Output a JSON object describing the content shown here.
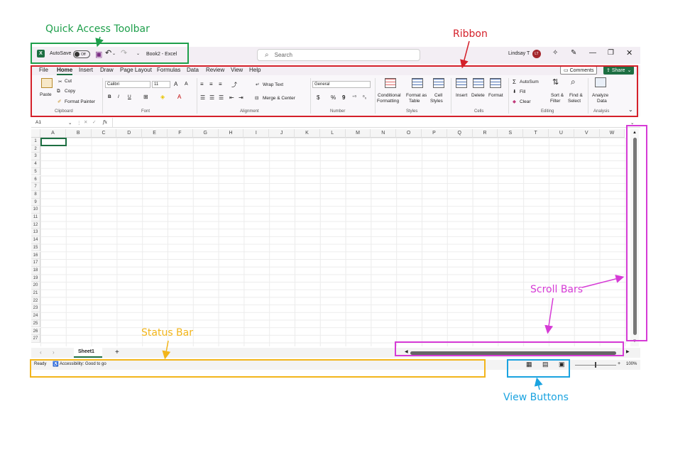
{
  "annotations": {
    "quick_access": "Quick Access Toolbar",
    "ribbon": "Ribbon",
    "scroll_bars": "Scroll Bars",
    "status_bar": "Status Bar",
    "view_buttons": "View Buttons"
  },
  "colors": {
    "green": "#1e9f4b",
    "red": "#d4202a",
    "magenta": "#d63bd6",
    "orange": "#f2b51b",
    "blue": "#1aa3e0",
    "excel_green": "#1d6f42"
  },
  "titlebar": {
    "logo": "X",
    "autosave": "AutoSave",
    "autosave_state": "Off",
    "doc_title": "Book2 - Excel",
    "search_placeholder": "Search",
    "user_name": "Lindsay T",
    "user_initials": "LT"
  },
  "menu": {
    "tabs": [
      "File",
      "Home",
      "Insert",
      "Draw",
      "Page Layout",
      "Formulas",
      "Data",
      "Review",
      "View",
      "Help"
    ],
    "comments": "Comments",
    "share": "Share"
  },
  "ribbon": {
    "clipboard": {
      "paste": "Paste",
      "cut": "Cut",
      "copy": "Copy",
      "format_painter": "Format Painter",
      "label": "Clipboard"
    },
    "font": {
      "name": "Calibri",
      "size": "11",
      "bold": "B",
      "italic": "I",
      "underline": "U",
      "grow": "A",
      "shrink": "A",
      "label": "Font"
    },
    "alignment": {
      "wrap": "Wrap Text",
      "merge": "Merge & Center",
      "label": "Alignment"
    },
    "number": {
      "format": "General",
      "currency": "$",
      "percent": "%",
      "comma": "9",
      "label": "Number"
    },
    "styles": {
      "conditional": "Conditional",
      "conditional2": "Formatting",
      "table": "Format as",
      "table2": "Table",
      "cell": "Cell",
      "cell2": "Styles",
      "label": "Styles"
    },
    "cells": {
      "insert": "Insert",
      "delete": "Delete",
      "format": "Format",
      "label": "Cells"
    },
    "editing": {
      "autosum": "AutoSum",
      "fill": "Fill",
      "clear": "Clear",
      "sort": "Sort &",
      "sort2": "Filter",
      "find": "Find &",
      "find2": "Select",
      "label": "Editing"
    },
    "analysis": {
      "analyze": "Analyze",
      "analyze2": "Data",
      "label": "Analysis"
    }
  },
  "formula_bar": {
    "name_box": "A1",
    "fx": "fx"
  },
  "columns": [
    "A",
    "B",
    "C",
    "D",
    "E",
    "F",
    "G",
    "H",
    "I",
    "J",
    "K",
    "L",
    "M",
    "N",
    "O",
    "P",
    "Q",
    "R",
    "S",
    "T",
    "U",
    "V",
    "W"
  ],
  "rows": [
    "1",
    "2",
    "3",
    "4",
    "5",
    "6",
    "7",
    "8",
    "9",
    "10",
    "11",
    "12",
    "13",
    "14",
    "15",
    "16",
    "17",
    "18",
    "19",
    "20",
    "21",
    "22",
    "23",
    "24",
    "25",
    "26",
    "27"
  ],
  "sheet": {
    "name": "Sheet1",
    "add": "+"
  },
  "status": {
    "ready": "Ready",
    "accessibility": "Accessibility: Good to go",
    "zoom": "100%"
  }
}
